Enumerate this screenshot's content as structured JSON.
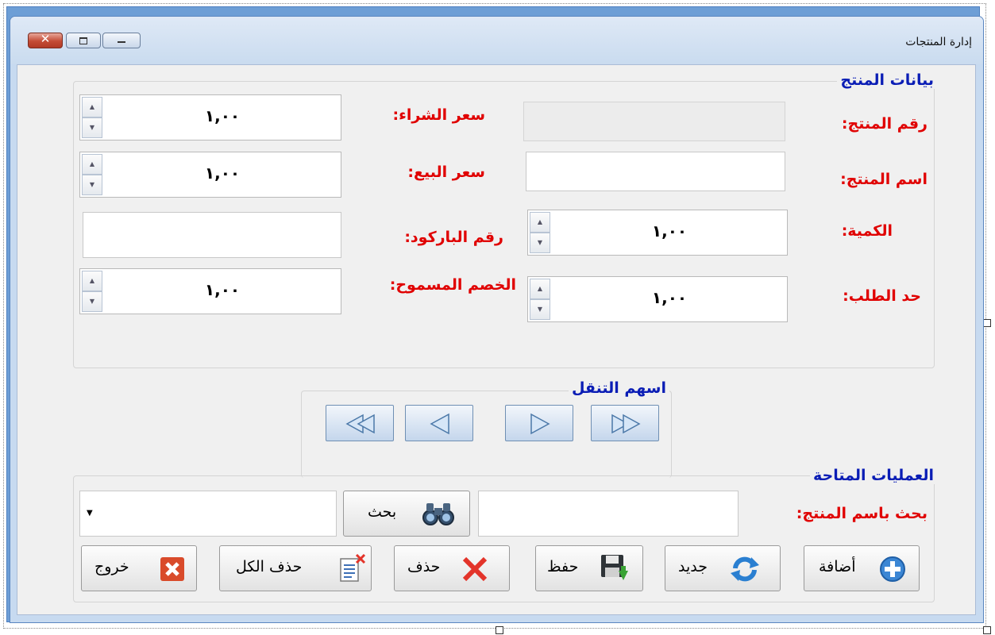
{
  "window": {
    "title": "إدارة المنتجات",
    "controls": {
      "close": "✕"
    }
  },
  "product_group": {
    "title": "بيانات المنتج",
    "product_id_label": "رقم المنتج:",
    "product_id_value": "",
    "product_name_label": "اسم المنتج:",
    "product_name_value": "",
    "quantity_label": "الكمية:",
    "quantity_value": "١,٠٠",
    "reorder_label": "حد الطلب:",
    "reorder_value": "١,٠٠",
    "purchase_price_label": "سعر الشراء:",
    "purchase_price_value": "١,٠٠",
    "sale_price_label": "سعر البيع:",
    "sale_price_value": "١,٠٠",
    "barcode_label": "رقم الباركود:",
    "barcode_value": "",
    "discount_label": "الخصم المسموح:",
    "discount_value": "١,٠٠"
  },
  "nav_group": {
    "title": "اسهم التنقل"
  },
  "ops_group": {
    "title": "العمليات المتاحة",
    "search_label": "بحث باسم المنتج:",
    "search_value": "",
    "search_button": "بحث",
    "combo_value": "",
    "add_button": "أضافة",
    "new_button": "جديد",
    "save_button": "حفظ",
    "delete_button": "حذف",
    "delete_all_button": "حذف الكل",
    "exit_button": "خروج"
  },
  "colors": {
    "label_red": "#e00000",
    "group_title_blue": "#0a1db5",
    "frame_blue": "#6d9ed6"
  }
}
